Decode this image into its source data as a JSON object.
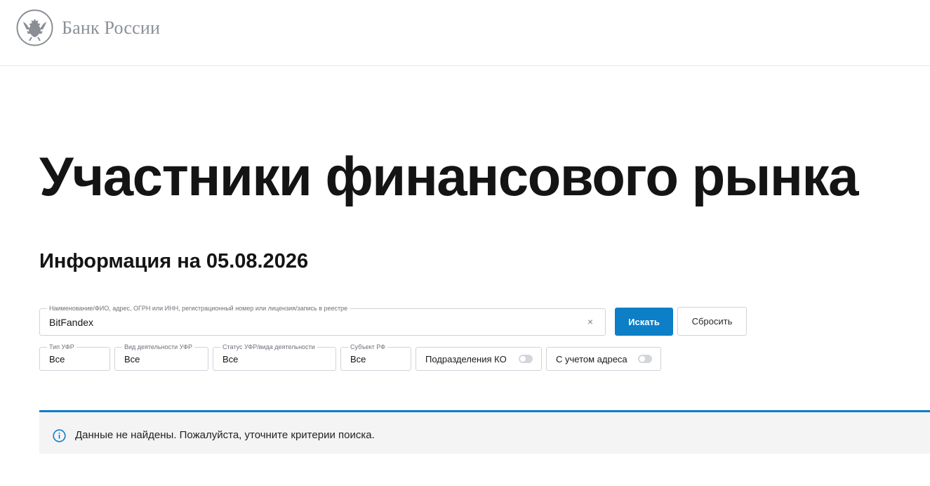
{
  "header": {
    "brand": "Банк России",
    "emblem_icon": "double-headed-eagle-icon"
  },
  "main": {
    "title": "Участники финансового рынка",
    "info_date": "Информация на 05.08.2026"
  },
  "search": {
    "legend": "Наименование/ФИО, адрес, ОГРН или ИНН, регистрационный номер или лицензия/запись в реестре",
    "value": "BitFandex",
    "clear_symbol": "×",
    "search_button": "Искать",
    "reset_button": "Сбросить"
  },
  "filters": [
    {
      "legend": "Тип УФР",
      "value": "Все"
    },
    {
      "legend": "Вид деятельности УФР",
      "value": "Все"
    },
    {
      "legend": "Статус УФР/вида деятельности",
      "value": "Все"
    },
    {
      "legend": "Субъект РФ",
      "value": "Все"
    }
  ],
  "toggles": [
    {
      "label": "Подразделения КО",
      "on": false
    },
    {
      "label": "С учетом адреса",
      "on": false
    }
  ],
  "notice": {
    "text": "Данные не найдены. Пожалуйста, уточните критерии поиска.",
    "icon": "info-icon",
    "accent_color": "#0c7fc7"
  },
  "colors": {
    "primary": "#0c7fc7",
    "brand_gray": "#8a8f96",
    "border": "#cfd3d8"
  }
}
